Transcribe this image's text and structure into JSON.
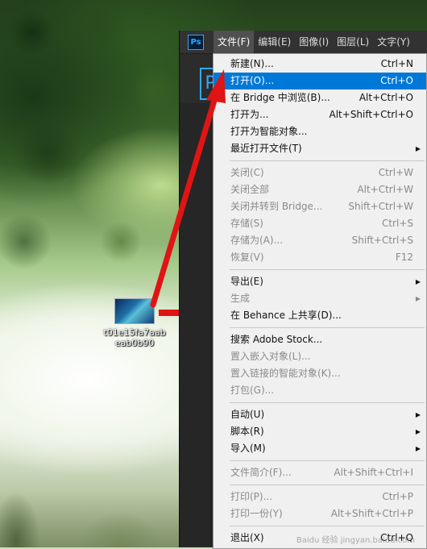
{
  "desktop": {
    "icon_label": "t01e15fa7aabeab0b90"
  },
  "ps": {
    "logo": "Ps",
    "big_logo": "P",
    "menus": [
      {
        "label": "文件(F)",
        "active": true
      },
      {
        "label": "编辑(E)",
        "active": false
      },
      {
        "label": "图像(I)",
        "active": false
      },
      {
        "label": "图层(L)",
        "active": false
      },
      {
        "label": "文字(Y)",
        "active": false
      }
    ]
  },
  "file_menu": {
    "items": [
      {
        "label": "新建(N)...",
        "shortcut": "Ctrl+N"
      },
      {
        "label": "打开(O)...",
        "shortcut": "Ctrl+O"
      },
      {
        "label": "在 Bridge 中浏览(B)...",
        "shortcut": "Alt+Ctrl+O"
      },
      {
        "label": "打开为...",
        "shortcut": "Alt+Shift+Ctrl+O"
      },
      {
        "label": "打开为智能对象...",
        "shortcut": ""
      },
      {
        "label": "最近打开文件(T)",
        "shortcut": ""
      },
      {
        "label": "关闭(C)",
        "shortcut": "Ctrl+W"
      },
      {
        "label": "关闭全部",
        "shortcut": "Alt+Ctrl+W"
      },
      {
        "label": "关闭并转到 Bridge...",
        "shortcut": "Shift+Ctrl+W"
      },
      {
        "label": "存储(S)",
        "shortcut": "Ctrl+S"
      },
      {
        "label": "存储为(A)...",
        "shortcut": "Shift+Ctrl+S"
      },
      {
        "label": "恢复(V)",
        "shortcut": "F12"
      },
      {
        "label": "导出(E)",
        "shortcut": ""
      },
      {
        "label": "生成",
        "shortcut": ""
      },
      {
        "label": "在 Behance 上共享(D)...",
        "shortcut": ""
      },
      {
        "label": "搜索 Adobe Stock...",
        "shortcut": ""
      },
      {
        "label": "置入嵌入对象(L)...",
        "shortcut": ""
      },
      {
        "label": "置入链接的智能对象(K)...",
        "shortcut": ""
      },
      {
        "label": "打包(G)...",
        "shortcut": ""
      },
      {
        "label": "自动(U)",
        "shortcut": ""
      },
      {
        "label": "脚本(R)",
        "shortcut": ""
      },
      {
        "label": "导入(M)",
        "shortcut": ""
      },
      {
        "label": "文件简介(F)...",
        "shortcut": "Alt+Shift+Ctrl+I"
      },
      {
        "label": "打印(P)...",
        "shortcut": "Ctrl+P"
      },
      {
        "label": "打印一份(Y)",
        "shortcut": "Alt+Shift+Ctrl+P"
      },
      {
        "label": "退出(X)",
        "shortcut": "Ctrl+Q"
      }
    ]
  },
  "watermark": "Baidu 经验 jingyan.baidu.com",
  "colors": {
    "highlight": "#0078d7",
    "annotation_red": "#e01414",
    "ps_blue": "#31a8ff"
  }
}
